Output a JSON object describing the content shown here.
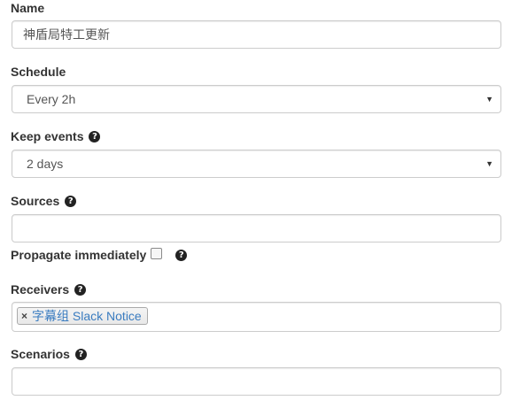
{
  "form": {
    "name": {
      "label": "Name",
      "value": "神盾局特工更新"
    },
    "schedule": {
      "label": "Schedule",
      "value": "Every 2h",
      "caret": "▼"
    },
    "keep_events": {
      "label": "Keep events",
      "value": "2 days",
      "caret": "▼",
      "help": "?"
    },
    "sources": {
      "label": "Sources",
      "value": "",
      "help": "?"
    },
    "propagate": {
      "label": "Propagate immediately",
      "checked": false,
      "help": "?"
    },
    "receivers": {
      "label": "Receivers",
      "help": "?",
      "tags": [
        {
          "remove": "×",
          "label": "字幕组 Slack Notice"
        }
      ]
    },
    "scenarios": {
      "label": "Scenarios",
      "value": "",
      "help": "?"
    }
  },
  "colors": {
    "tag_text": "#3a7cc0",
    "border": "#cccccc"
  }
}
